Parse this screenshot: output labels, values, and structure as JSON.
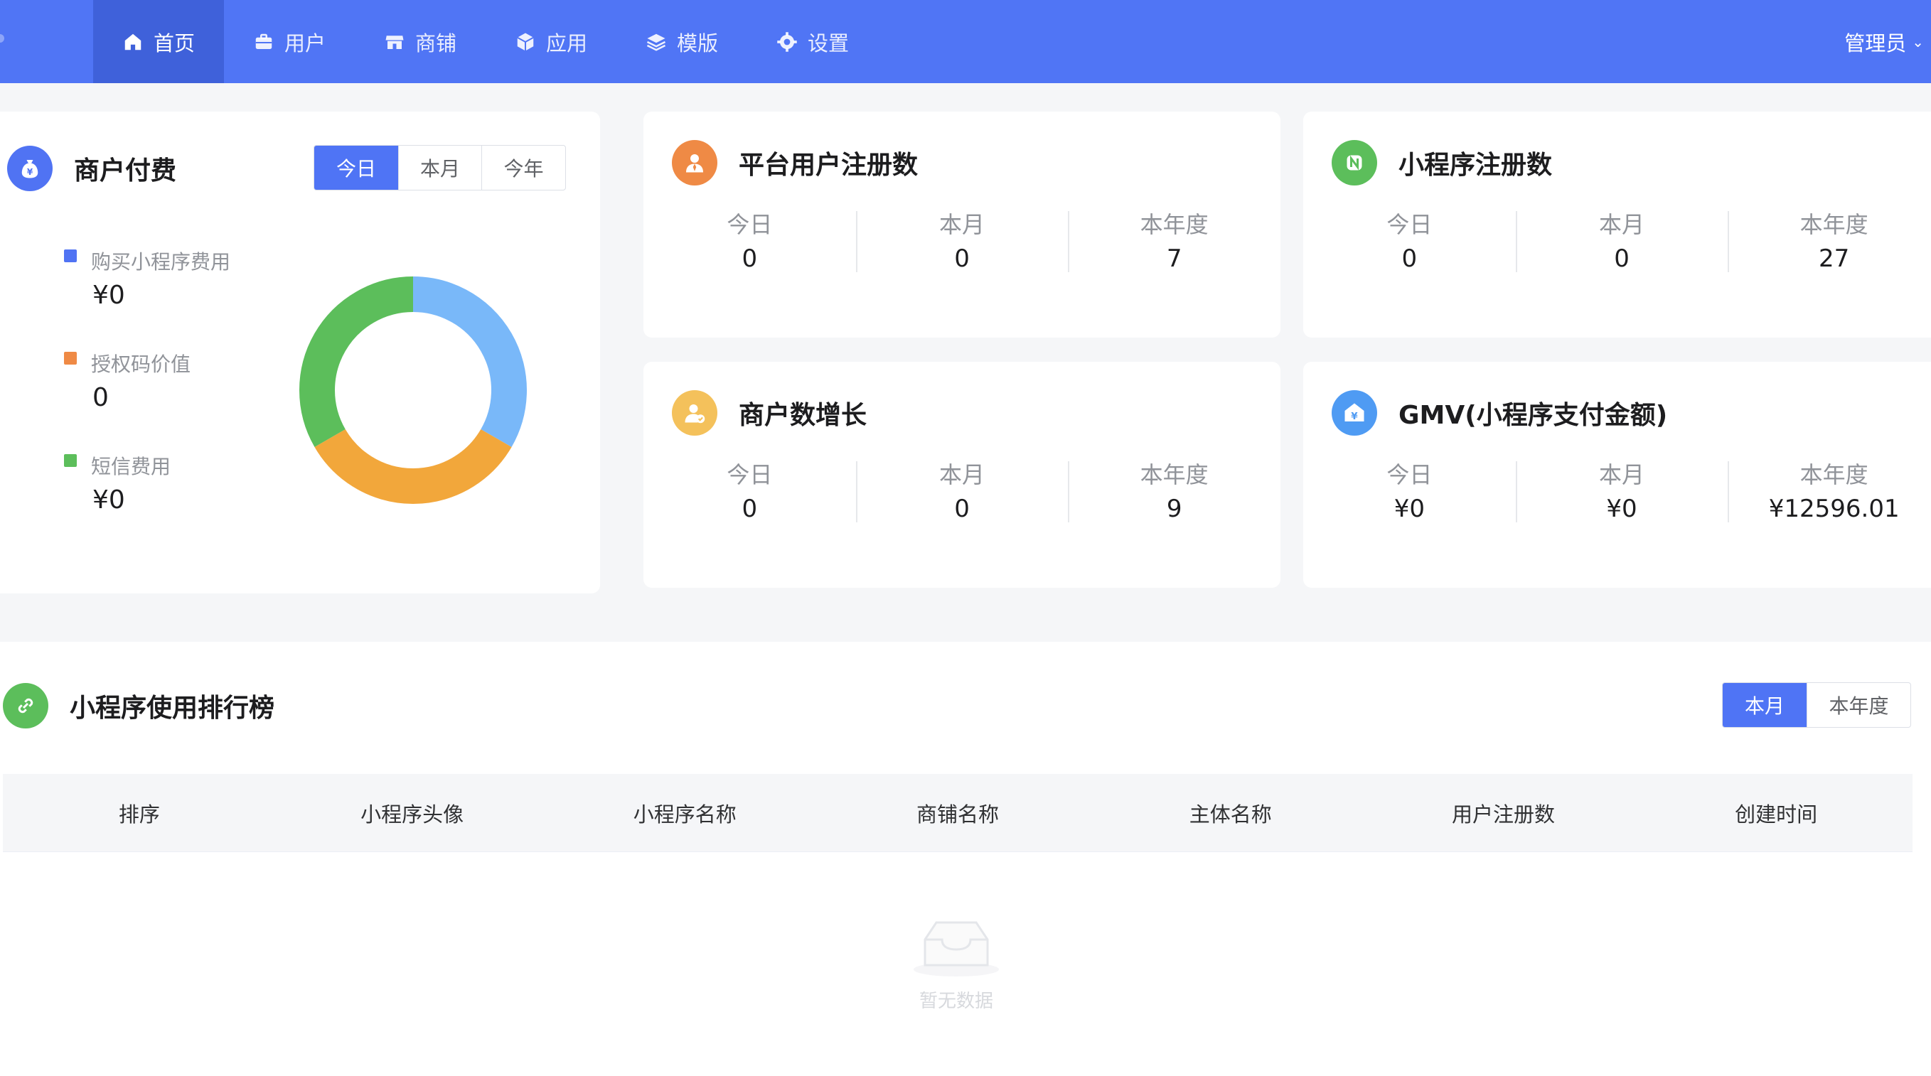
{
  "nav": {
    "items": [
      {
        "label": "首页",
        "icon": "home-icon",
        "active": true
      },
      {
        "label": "用户",
        "icon": "briefcase-icon",
        "active": false
      },
      {
        "label": "商铺",
        "icon": "store-icon",
        "active": false
      },
      {
        "label": "应用",
        "icon": "cube-icon",
        "active": false
      },
      {
        "label": "模版",
        "icon": "layers-icon",
        "active": false
      },
      {
        "label": "设置",
        "icon": "gear-icon",
        "active": false
      }
    ],
    "admin_label": "管理员",
    "admin_chevron": "⌄"
  },
  "merchant_pay": {
    "title": "商户付费",
    "ranges": [
      "今日",
      "本月",
      "今年"
    ],
    "active_range": "今日",
    "legend": [
      {
        "label": "购买小程序费用",
        "value": "¥0",
        "color": "#5073f3"
      },
      {
        "label": "授权码价值",
        "value": "0",
        "color": "#ef8a45"
      },
      {
        "label": "短信费用",
        "value": "¥0",
        "color": "#5cbe5b"
      }
    ],
    "donut": {
      "segments": [
        {
          "name": "blue",
          "fraction": 0.3333,
          "color": "#79b8f9"
        },
        {
          "name": "orange",
          "fraction": 0.3333,
          "color": "#f2a73b"
        },
        {
          "name": "green",
          "fraction": 0.3334,
          "color": "#5cbe5b"
        }
      ]
    }
  },
  "stats_cards": [
    {
      "title": "平台用户注册数",
      "icon": "user-tie-icon",
      "icon_color": "#ef8a45",
      "labels": [
        "今日",
        "本月",
        "本年度"
      ],
      "values": [
        "0",
        "0",
        "7"
      ]
    },
    {
      "title": "小程序注册数",
      "icon": "miniprogram-n-icon",
      "icon_color": "#5cbe5b",
      "labels": [
        "今日",
        "本月",
        "本年度"
      ],
      "values": [
        "0",
        "0",
        "27"
      ]
    },
    {
      "title": "商户数增长",
      "icon": "user-check-icon",
      "icon_color": "#f4c15b",
      "labels": [
        "今日",
        "本月",
        "本年度"
      ],
      "values": [
        "0",
        "0",
        "9"
      ]
    },
    {
      "title": "GMV(小程序支付金额)",
      "icon": "yuan-house-icon",
      "icon_color": "#4f9bf3",
      "labels": [
        "今日",
        "本月",
        "本年度"
      ],
      "values": [
        "¥0",
        "¥0",
        "¥12596.01"
      ]
    }
  ],
  "ranking": {
    "title": "小程序使用排行榜",
    "ranges": [
      "本月",
      "本年度"
    ],
    "active_range": "本月",
    "columns": [
      "排序",
      "小程序头像",
      "小程序名称",
      "商铺名称",
      "主体名称",
      "用户注册数",
      "创建时间"
    ],
    "rows": [],
    "empty_text": "暂无数据"
  }
}
